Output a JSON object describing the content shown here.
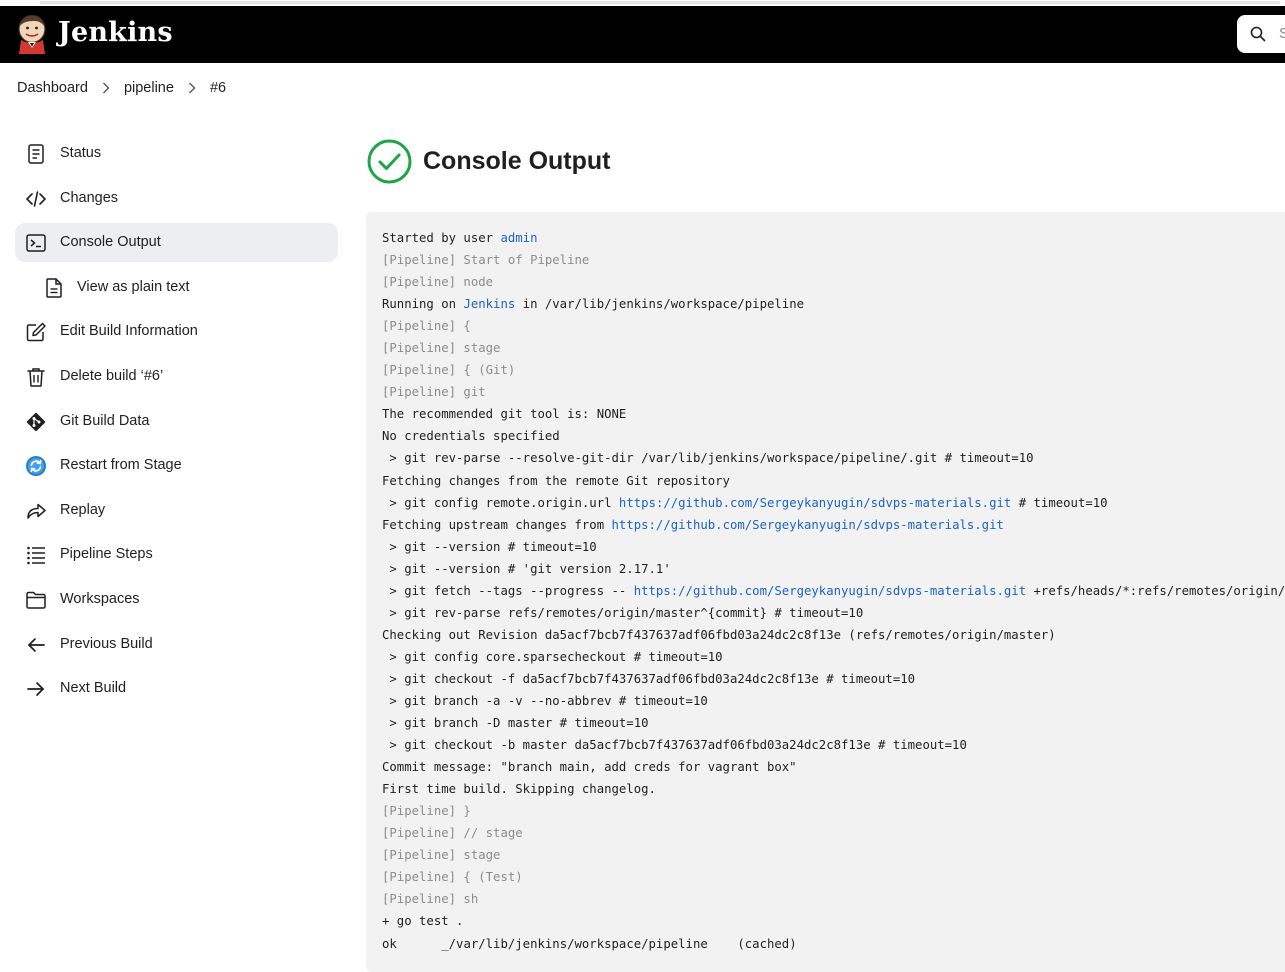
{
  "header": {
    "brand": "Jenkins",
    "search_placeholder": "S"
  },
  "breadcrumb": [
    "Dashboard",
    "pipeline",
    "#6"
  ],
  "sidebar": {
    "items": [
      {
        "label": "Status",
        "icon": "status-document-icon"
      },
      {
        "label": "Changes",
        "icon": "code-icon"
      },
      {
        "label": "Console Output",
        "icon": "terminal-icon",
        "active": true
      },
      {
        "label": "View as plain text",
        "icon": "document-icon",
        "sub": true
      },
      {
        "label": "Edit Build Information",
        "icon": "edit-icon"
      },
      {
        "label": "Delete build ‘#6’",
        "icon": "trash-icon"
      },
      {
        "label": "Git Build Data",
        "icon": "git-icon"
      },
      {
        "label": "Restart from Stage",
        "icon": "restart-icon"
      },
      {
        "label": "Replay",
        "icon": "replay-icon"
      },
      {
        "label": "Pipeline Steps",
        "icon": "list-icon"
      },
      {
        "label": "Workspaces",
        "icon": "folder-icon"
      },
      {
        "label": "Previous Build",
        "icon": "arrow-left-icon"
      },
      {
        "label": "Next Build",
        "icon": "arrow-right-icon"
      }
    ]
  },
  "main": {
    "title": "Console Output",
    "status_color": "#1ea446"
  },
  "console": {
    "lines": [
      [
        {
          "t": "Started by user "
        },
        {
          "t": "admin",
          "link": true
        }
      ],
      [
        {
          "t": "[Pipeline] Start of Pipeline",
          "dim": true
        }
      ],
      [
        {
          "t": "[Pipeline] node",
          "dim": true
        }
      ],
      [
        {
          "t": "Running on "
        },
        {
          "t": "Jenkins",
          "link": true
        },
        {
          "t": " in /var/lib/jenkins/workspace/pipeline"
        }
      ],
      [
        {
          "t": "[Pipeline] {",
          "dim": true
        }
      ],
      [
        {
          "t": "[Pipeline] stage",
          "dim": true
        }
      ],
      [
        {
          "t": "[Pipeline] { (Git)",
          "dim": true
        }
      ],
      [
        {
          "t": "[Pipeline] git",
          "dim": true
        }
      ],
      [
        {
          "t": "The recommended git tool is: NONE"
        }
      ],
      [
        {
          "t": "No credentials specified"
        }
      ],
      [
        {
          "t": " > git rev-parse --resolve-git-dir /var/lib/jenkins/workspace/pipeline/.git # timeout=10"
        }
      ],
      [
        {
          "t": "Fetching changes from the remote Git repository"
        }
      ],
      [
        {
          "t": " > git config remote.origin.url "
        },
        {
          "t": "https://github.com/Sergeykanyugin/sdvps-materials.git",
          "link": true
        },
        {
          "t": " # timeout=10"
        }
      ],
      [
        {
          "t": "Fetching upstream changes from "
        },
        {
          "t": "https://github.com/Sergeykanyugin/sdvps-materials.git",
          "link": true
        }
      ],
      [
        {
          "t": " > git --version # timeout=10"
        }
      ],
      [
        {
          "t": " > git --version # 'git version 2.17.1'"
        }
      ],
      [
        {
          "t": " > git fetch --tags --progress -- "
        },
        {
          "t": "https://github.com/Sergeykanyugin/sdvps-materials.git",
          "link": true
        },
        {
          "t": " +refs/heads/*:refs/remotes/origin/* "
        }
      ],
      [
        {
          "t": " > git rev-parse refs/remotes/origin/master^{commit} # timeout=10"
        }
      ],
      [
        {
          "t": "Checking out Revision da5acf7bcb7f437637adf06fbd03a24dc2c8f13e (refs/remotes/origin/master)"
        }
      ],
      [
        {
          "t": " > git config core.sparsecheckout # timeout=10"
        }
      ],
      [
        {
          "t": " > git checkout -f da5acf7bcb7f437637adf06fbd03a24dc2c8f13e # timeout=10"
        }
      ],
      [
        {
          "t": " > git branch -a -v --no-abbrev # timeout=10"
        }
      ],
      [
        {
          "t": " > git branch -D master # timeout=10"
        }
      ],
      [
        {
          "t": " > git checkout -b master da5acf7bcb7f437637adf06fbd03a24dc2c8f13e # timeout=10"
        }
      ],
      [
        {
          "t": "Commit message: \"branch main, add creds for vagrant box\""
        }
      ],
      [
        {
          "t": "First time build. Skipping changelog."
        }
      ],
      [
        {
          "t": "[Pipeline] }",
          "dim": true
        }
      ],
      [
        {
          "t": "[Pipeline] // stage",
          "dim": true
        }
      ],
      [
        {
          "t": "[Pipeline] stage",
          "dim": true
        }
      ],
      [
        {
          "t": "[Pipeline] { (Test)",
          "dim": true
        }
      ],
      [
        {
          "t": "[Pipeline] sh",
          "dim": true
        }
      ],
      [
        {
          "t": "+ go test ."
        }
      ],
      [
        {
          "t": "ok  \t_/var/lib/jenkins/workspace/pipeline\t(cached)"
        }
      ]
    ]
  }
}
